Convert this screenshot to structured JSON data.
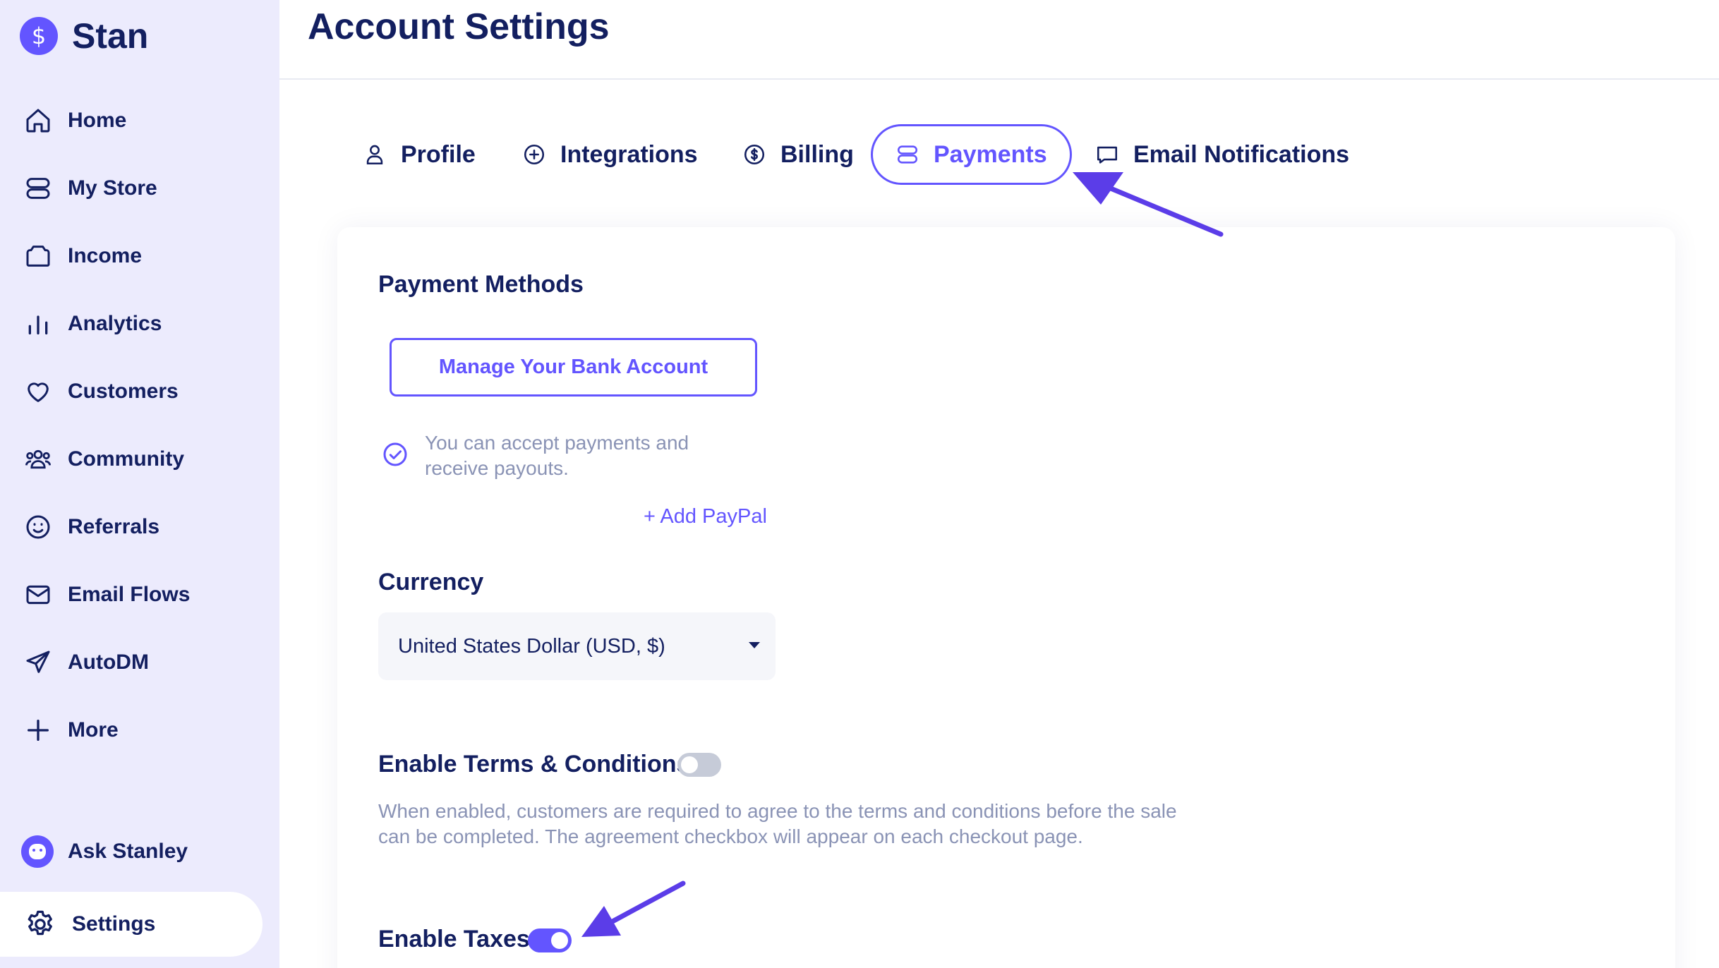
{
  "brand": {
    "name": "Stan",
    "logo_glyph": "$"
  },
  "sidebar": {
    "items": [
      {
        "label": "Home",
        "icon": "home-icon"
      },
      {
        "label": "My Store",
        "icon": "store-icon"
      },
      {
        "label": "Income",
        "icon": "wallet-icon"
      },
      {
        "label": "Analytics",
        "icon": "bar-chart-icon"
      },
      {
        "label": "Customers",
        "icon": "heart-icon"
      },
      {
        "label": "Community",
        "icon": "people-icon"
      },
      {
        "label": "Referrals",
        "icon": "smiley-icon"
      },
      {
        "label": "Email Flows",
        "icon": "mail-icon"
      },
      {
        "label": "AutoDM",
        "icon": "send-icon"
      },
      {
        "label": "More",
        "icon": "plus-icon"
      }
    ],
    "ask_label": "Ask Stanley",
    "settings_label": "Settings"
  },
  "header": {
    "title": "Account Settings"
  },
  "tabs": [
    {
      "label": "Profile",
      "icon": "user-icon",
      "active": false
    },
    {
      "label": "Integrations",
      "icon": "plus-circle-icon",
      "active": false
    },
    {
      "label": "Billing",
      "icon": "dollar-circle-icon",
      "active": false
    },
    {
      "label": "Payments",
      "icon": "payments-icon",
      "active": true
    },
    {
      "label": "Email Notifications",
      "icon": "chat-icon",
      "active": false
    }
  ],
  "payments": {
    "methods_title": "Payment Methods",
    "manage_bank_label": "Manage Your Bank Account",
    "status_text": "You can accept payments and receive payouts.",
    "add_paypal_label": "+ Add PayPal",
    "currency_title": "Currency",
    "currency_value": "United States Dollar (USD, $)",
    "terms_title": "Enable Terms & Conditions",
    "terms_enabled": false,
    "terms_desc": "When enabled, customers are required to agree to the terms and conditions before the sale can be completed. The agreement checkbox will appear on each checkout page.",
    "taxes_title": "Enable Taxes",
    "taxes_enabled": true
  },
  "colors": {
    "accent": "#6355ff",
    "sidebar_bg": "#ecebfd",
    "text_primary": "#131f60",
    "text_muted": "#8a93b5"
  }
}
